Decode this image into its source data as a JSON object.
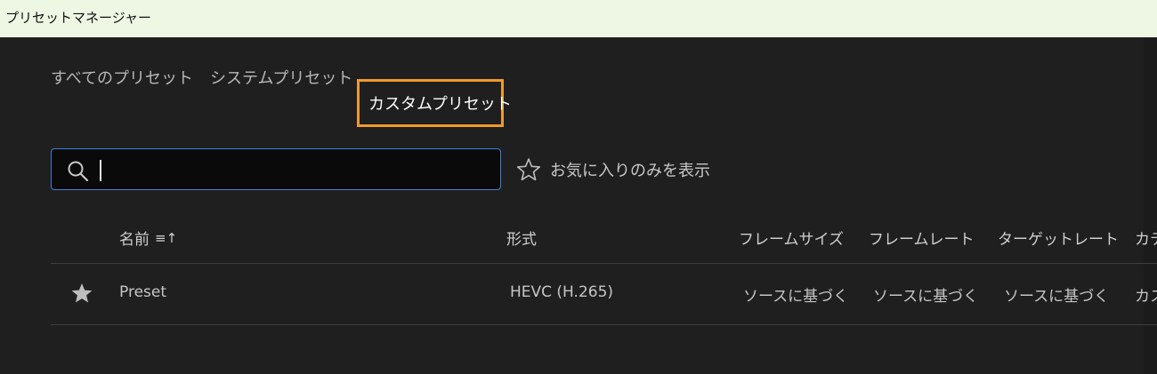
{
  "window": {
    "title": "プリセットマネージャー"
  },
  "tabs": {
    "all": "すべてのプリセット",
    "system": "システムプリセット",
    "custom": "カスタムプリセット"
  },
  "search": {
    "value": "",
    "placeholder": "",
    "icon": "search-icon"
  },
  "favorites_filter": {
    "label": "お気に入りのみを表示",
    "icon": "star-outline-icon"
  },
  "table": {
    "headers": {
      "name": "名前",
      "sort_icon": "≡↑",
      "format": "形式",
      "frame_size": "フレームサイズ",
      "frame_rate": "フレームレート",
      "target_rate": "ターゲットレート",
      "category": "カテ"
    },
    "rows": [
      {
        "favorite": true,
        "name": "Preset",
        "format": "HEVC (H.265)",
        "frame_size": "ソースに基づく",
        "frame_rate": "ソースに基づく",
        "target_rate": "ソースに基づく",
        "category": "カス"
      }
    ]
  },
  "colors": {
    "background": "#1f1f1f",
    "titlebar": "#eef6e4",
    "active_tab_outline": "#f09a2b",
    "search_border": "#3d7fd6"
  }
}
